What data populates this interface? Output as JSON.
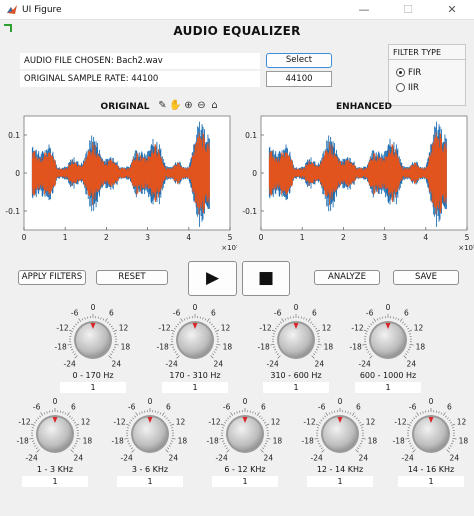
{
  "window": {
    "title": "UI Figure",
    "minimize_glyph": "—",
    "maximize_glyph": "☐",
    "close_glyph": "✕"
  },
  "app": {
    "title": "AUDIO EQUALIZER"
  },
  "file_info": {
    "file_chosen": "AUDIO FILE CHOSEN: Bach2.wav",
    "sample_rate": "ORIGINAL SAMPLE RATE: 44100",
    "select_label": "Select",
    "sample_rate_value": "44100"
  },
  "filter_type": {
    "title": "FILTER TYPE",
    "options": [
      {
        "label": "FIR",
        "selected": true
      },
      {
        "label": "IIR",
        "selected": false
      }
    ]
  },
  "axes_toolbar": [
    "edit-icon",
    "pan-icon",
    "zoom-in-icon",
    "zoom-out-icon",
    "home-icon"
  ],
  "charts": [
    {
      "title": "ORIGINAL",
      "type": "area",
      "x_ticks": [
        "0",
        "1",
        "2",
        "3",
        "4",
        "5"
      ],
      "x_exponent": "×10⁵",
      "y_ticks": [
        "0.1",
        "0",
        "-0.1"
      ],
      "xlim": [
        0,
        500000
      ],
      "ylim": [
        -0.15,
        0.15
      ],
      "series": [
        {
          "color": "#1f6fb4"
        },
        {
          "color": "#e2541f"
        }
      ]
    },
    {
      "title": "ENHANCED",
      "type": "area",
      "x_ticks": [
        "0",
        "1",
        "2",
        "3",
        "4",
        "5"
      ],
      "x_exponent": "×10⁵",
      "y_ticks": [
        "0.1",
        "0",
        "-0.1"
      ],
      "xlim": [
        0,
        500000
      ],
      "ylim": [
        -0.15,
        0.15
      ],
      "series": [
        {
          "color": "#1f6fb4"
        },
        {
          "color": "#e2541f"
        }
      ]
    }
  ],
  "buttons": {
    "apply": "APPLY FILTERS",
    "reset": "RESET",
    "play_glyph": "▶",
    "stop_glyph": "■",
    "analyze": "ANALYZE",
    "save": "SAVE"
  },
  "knob_scale": [
    "-24",
    "-18",
    "-12",
    "-6",
    "0",
    "6",
    "12",
    "18",
    "24"
  ],
  "knobs": [
    {
      "label": "0 - 170 Hz",
      "value": "1"
    },
    {
      "label": "170 -  310 Hz",
      "value": "1"
    },
    {
      "label": "310 - 600 Hz",
      "value": "1"
    },
    {
      "label": "600 - 1000 Hz",
      "value": "1"
    },
    {
      "label": "1 - 3 KHz",
      "value": "1"
    },
    {
      "label": "3 - 6 KHz",
      "value": "1"
    },
    {
      "label": "6 - 12 KHz",
      "value": "1"
    },
    {
      "label": "12 - 14 KHz",
      "value": "1"
    },
    {
      "label": "14 - 16 KHz",
      "value": "1"
    }
  ],
  "colors": {
    "accent": "#3b8ede",
    "indicator": "#d9262b",
    "corner_mark": "#2fa02f"
  }
}
